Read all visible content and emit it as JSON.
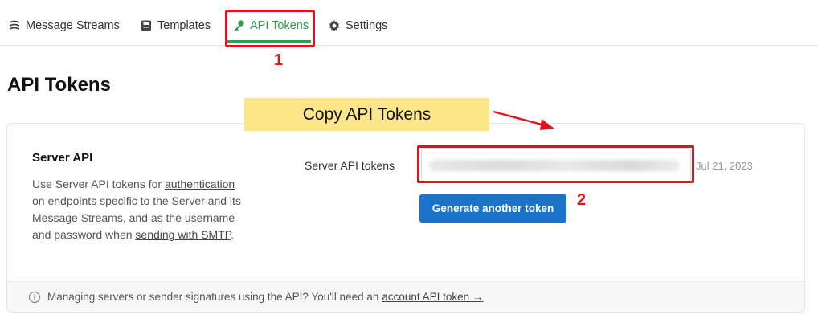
{
  "nav": {
    "items": [
      {
        "label": "Message Streams",
        "icon": "streams-icon"
      },
      {
        "label": "Templates",
        "icon": "template-icon"
      },
      {
        "label": "API Tokens",
        "icon": "key-icon",
        "active": true
      },
      {
        "label": "Settings",
        "icon": "gear-icon"
      }
    ]
  },
  "page": {
    "title": "API Tokens"
  },
  "annotations": {
    "callout": "Copy API Tokens",
    "marker_1": "1",
    "marker_2": "2",
    "color": "#e0141d",
    "callout_bg": "#fde68a"
  },
  "server_api": {
    "title": "Server API",
    "desc_before": "Use Server API tokens for ",
    "desc_link1": "authentication",
    "desc_middle": " on endpoints specific to the Server and its Message Streams, and as the username and password when ",
    "desc_link2": "sending with SMTP",
    "desc_after": ".",
    "field_label": "Server API tokens",
    "token_date": "Jul 21, 2023",
    "generate_button": "Generate another token"
  },
  "footer": {
    "text": "Managing servers or sender signatures using the API? You'll need an ",
    "link": "account API token →"
  },
  "colors": {
    "accent": "#2e9c4a",
    "button": "#1a73c8"
  }
}
